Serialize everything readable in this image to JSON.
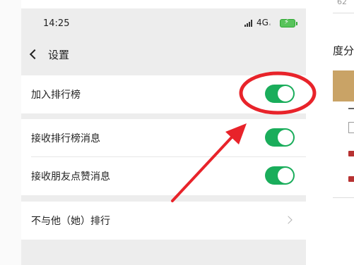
{
  "status_bar": {
    "time": "14:25",
    "network": "4G",
    "network_suffix": "ₓ"
  },
  "nav": {
    "title": "设置"
  },
  "settings": {
    "items": [
      {
        "label": "加入排行榜",
        "toggle_on": true
      },
      {
        "label": "接收排行榜消息",
        "toggle_on": true
      },
      {
        "label": "接收朋友点赞消息",
        "toggle_on": true
      },
      {
        "label": "不与他（她）排行"
      }
    ]
  },
  "background_page": {
    "top_number": "62",
    "partial_text": "度分"
  },
  "colors": {
    "toggle_on": "#1aad5b",
    "annotation": "#e8232a",
    "page_background": "#ededed"
  }
}
